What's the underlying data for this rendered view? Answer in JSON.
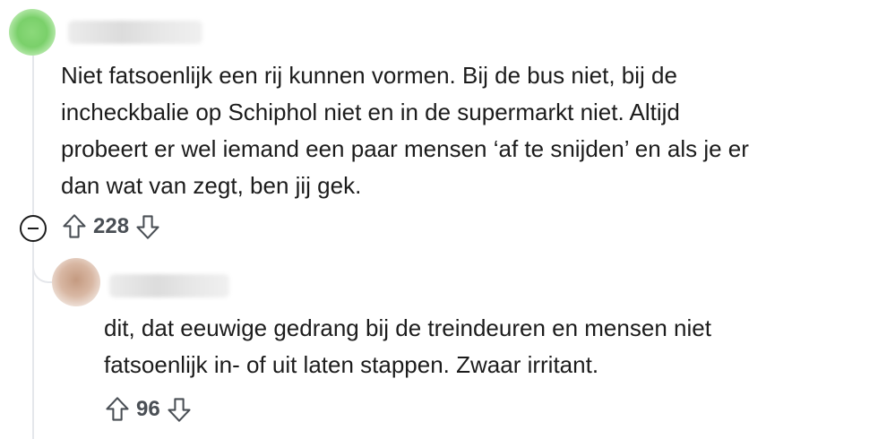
{
  "comments": [
    {
      "text_lines": [
        "Niet fatsoenlijk een rij kunnen vormen. Bij de bus niet, bij de",
        "incheckbalie op Schiphol niet en in de supermarkt niet. Altijd",
        "probeert er wel iemand een paar mensen ‘af te snijden’ en als je er",
        "dan wat van zegt, ben jij gek."
      ],
      "score": "228",
      "avatar_color": "#7ad06a"
    },
    {
      "text_lines": [
        "dit, dat eeuwige gedrang bij de treindeuren en mensen niet",
        "fatsoenlijk in- of uit laten stappen. Zwaar irritant."
      ],
      "score": "96",
      "avatar_color": "#c49a80"
    }
  ],
  "icons": {
    "collapse": "minus-circle-icon",
    "upvote": "arrow-up-icon",
    "downvote": "arrow-down-icon"
  }
}
